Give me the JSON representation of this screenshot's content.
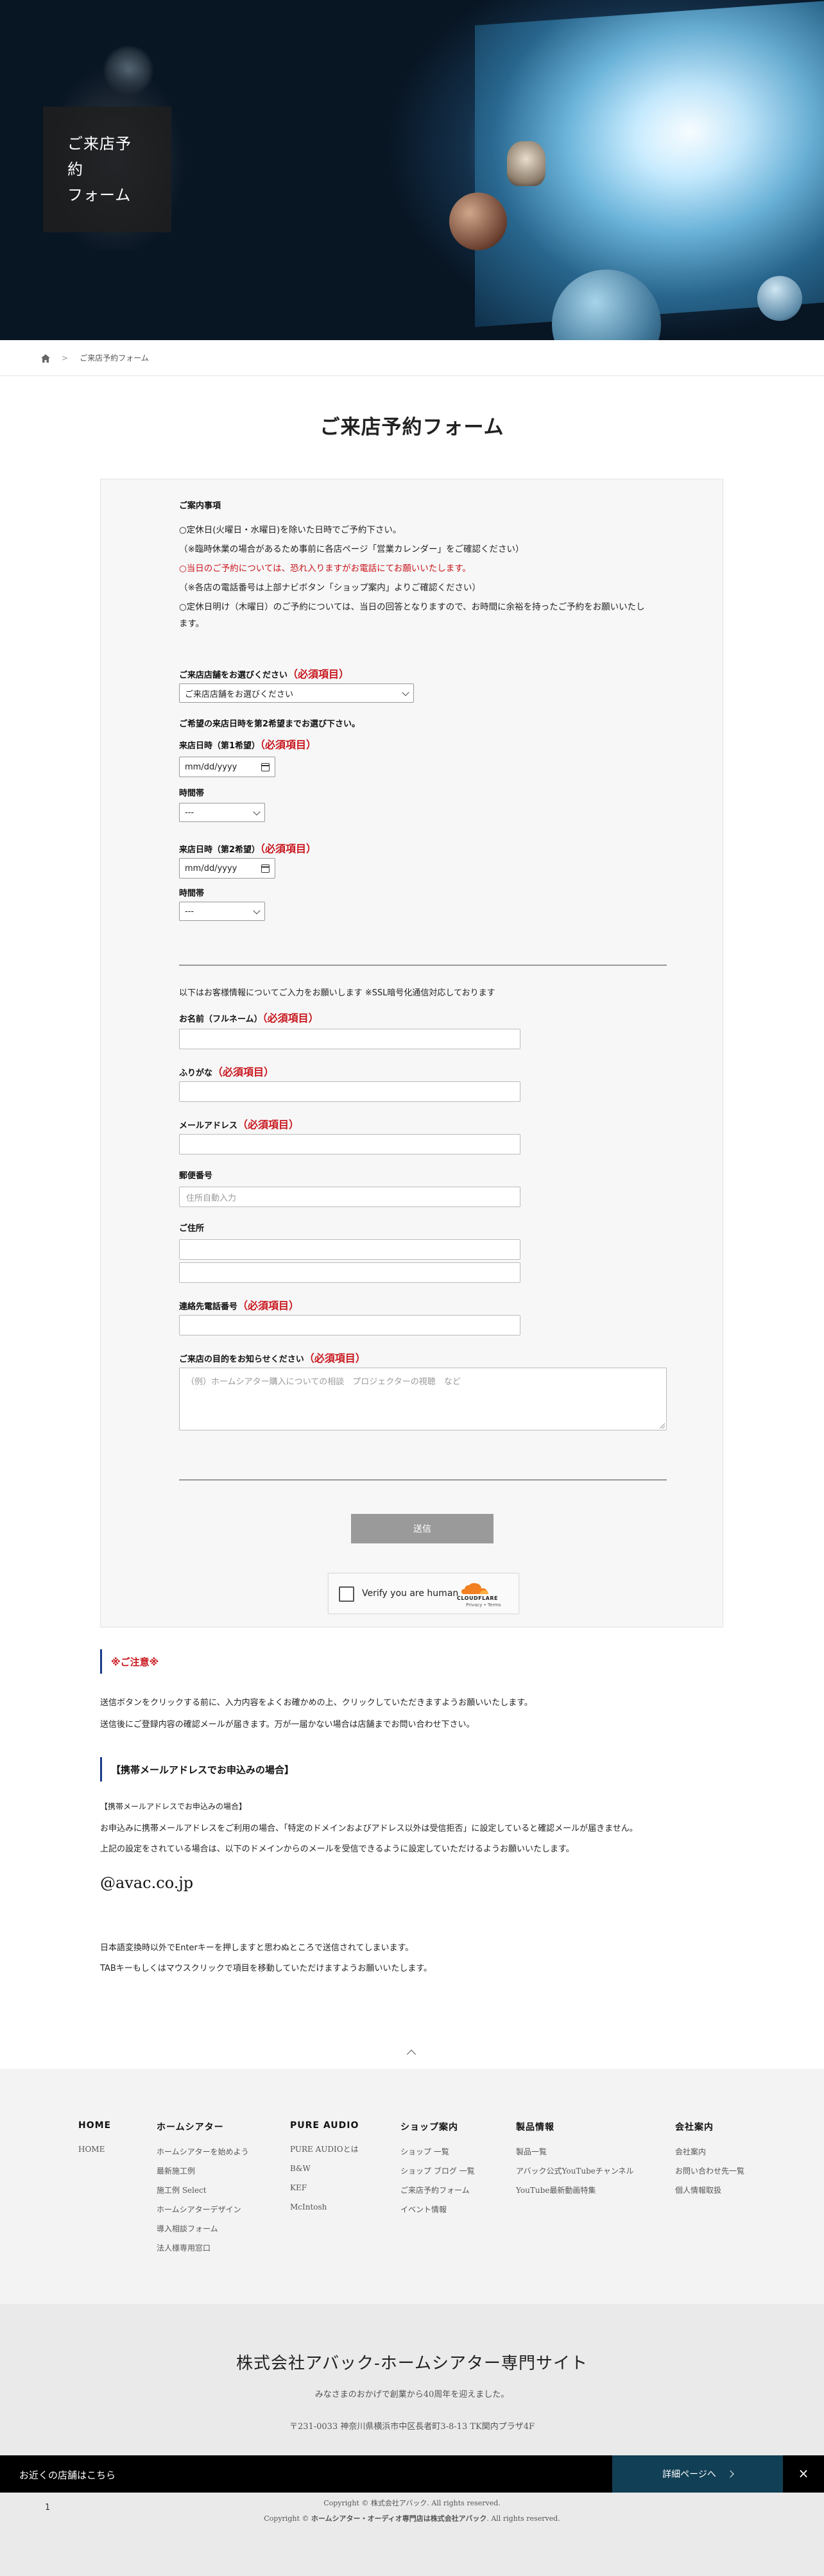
{
  "hero": {
    "title": "ご来店予約\nフォーム"
  },
  "breadcrumb": {
    "current": "ご来店予約フォーム"
  },
  "page_title": "ご来店予約フォーム",
  "notice": {
    "heading": "ご案内事項",
    "lines": [
      "○定休日(火曜日・水曜日)を除いた日時でご予約下さい。",
      "（※臨時休業の場合があるため事前に各店ページ「営業カレンダー」をご確認ください）",
      "○当日のご予約については、恐れ入りますがお電話にてお願いいたします。",
      "（※各店の電話番号は上部ナビボタン「ショップ案内」よりご確認ください）",
      "○定休日明け（木曜日）のご予約については、当日の回答となりますので、お時間に余裕を持ったご予約をお願いいたし",
      "ます。"
    ]
  },
  "required_mark": "（必須項目）",
  "store": {
    "label": "ご来店店舗をお選びください",
    "selected": "ご来店店舗をお選びください"
  },
  "datetime_intro": "ご希望の来店日時を第2希望までお選び下さい。",
  "date1": {
    "label": "来店日時（第1希望）",
    "value": "mm/dd/yyyy"
  },
  "time1": {
    "label": "時間帯",
    "selected": "---"
  },
  "date2": {
    "label": "来店日時（第2希望）",
    "value": "mm/dd/yyyy"
  },
  "time2": {
    "label": "時間帯",
    "selected": "---"
  },
  "customer_intro": "以下はお客様情報についてご入力をお願いします ※SSL暗号化通信対応しております",
  "fields": {
    "name": {
      "label": "お名前（フルネーム）",
      "value": ""
    },
    "kana": {
      "label": "ふりがな",
      "value": ""
    },
    "email": {
      "label": "メールアドレス",
      "value": ""
    },
    "zip": {
      "label": "郵便番号",
      "placeholder": "住所自動入力"
    },
    "address": {
      "label": "ご住所"
    },
    "phone": {
      "label": "連絡先電話番号",
      "value": ""
    },
    "purpose": {
      "label": "ご来店の目的をお知らせください",
      "placeholder": "（例）ホームシアター購入についての相談　プロジェクターの視聴　など"
    }
  },
  "submit_label": "送信",
  "captcha": {
    "label": "Verify you are human",
    "brand": "CLOUDFLARE",
    "links": "Privacy • Terms"
  },
  "caution": {
    "heading": "※ご注意※",
    "lines": [
      "送信ボタンをクリックする前に、入力内容をよくお確かめの上、クリックしていただきますようお願いいたします。",
      "送信後にご登録内容の確認メールが届きます。万が一届かない場合は店舗までお問い合わせ下さい。"
    ]
  },
  "mobile": {
    "heading": "【携帯メールアドレスでお申込みの場合】",
    "lines": [
      "【携帯メールアドレスでお申込みの場合】",
      "お申込みに携帯メールアドレスをご利用の場合、「特定のドメインおよびアドレス以外は受信拒否」に設定していると確認メールが届きません。",
      "上記の設定をされている場合は、以下のドメインからのメールを受信できるように設定していただけるようお願いいたします。"
    ],
    "domain": "@avac.co.jp"
  },
  "enter_note": [
    "日本語変換時以外でEnterキーを押しますと思わぬところで送信されてしまいます。",
    "TABキーもしくはマウスクリックで項目を移動していただけますようお願いいたします。"
  ],
  "footer": {
    "columns": [
      {
        "heading": "HOME",
        "items": [
          "HOME"
        ]
      },
      {
        "heading": "ホームシアター",
        "items": [
          "ホームシアターを始めよう",
          "最新施工例",
          "施工例 Select",
          "ホームシアターデザイン",
          "導入相談フォーム",
          "法人様専用窓口"
        ]
      },
      {
        "heading": "PURE AUDIO",
        "items": [
          "PURE AUDIOとは",
          "B&W",
          "KEF",
          "McIntosh"
        ]
      },
      {
        "heading": "ショップ案内",
        "items": [
          "ショップ 一覧",
          "ショップ ブログ 一覧",
          "ご来店予約フォーム",
          "イベント情報"
        ]
      },
      {
        "heading": "製品情報",
        "items": [
          "製品一覧",
          "アバック公式YouTubeチャンネル",
          "YouTube最新動画特集"
        ]
      },
      {
        "heading": "会社案内",
        "items": [
          "会社案内",
          "お問い合わせ先一覧",
          "個人情報取扱"
        ]
      }
    ]
  },
  "company": {
    "name": "株式会社アバック-ホームシアター専門サイト",
    "sub": "みなさまのおかげで創業から40周年を迎えました。",
    "address": "〒231-0033 神奈川県横浜市中区長者町3-8-13 TK関内プラザ4F"
  },
  "sticky": {
    "label": "お近くの店舗はこちら",
    "detail": "詳細ページへ",
    "close": "×"
  },
  "copyright": {
    "line1": "Copyright © 株式会社アバック. All rights reserved.",
    "line2_prefix": "Copyright © ",
    "line2_bold": "ホームシアター・オーディオ専門店は株式会社アバック",
    "line2_suffix": ". All rights reserved.",
    "number": "1"
  },
  "colors": {
    "required": "#c8161d",
    "accent_blue": "#1a3a8c",
    "sticky_button": "#113f55"
  }
}
